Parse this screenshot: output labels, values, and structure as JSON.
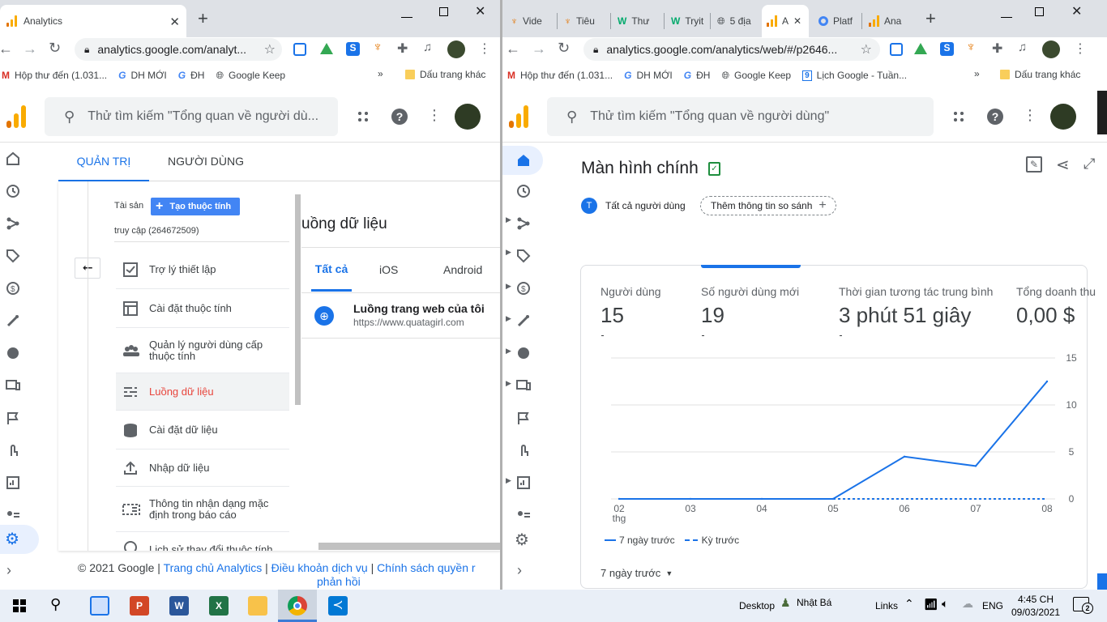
{
  "left_window": {
    "tab_title": "Analytics",
    "url": "analytics.google.com/analyt...",
    "bookmarks": [
      "Hộp thư đến (1.031...",
      "DH MỚI",
      "ĐH",
      "Google Keep"
    ],
    "bookmarks_other": "Dấu trang khác",
    "search_placeholder": "Thử tìm kiếm \"Tổng quan về người dù...",
    "tabs": [
      "QUẢN TRỊ",
      "NGƯỜI DÙNG"
    ],
    "property_label": "Tài sản",
    "create_property": "Tạo thuộc tính",
    "property_name": "truy cập (264672509)",
    "menu": [
      {
        "label": "Trợ lý thiết lập",
        "icon": "checklist-icon"
      },
      {
        "label": "Cài đặt thuộc tính",
        "icon": "property-settings-icon"
      },
      {
        "label": "Quản lý người dùng cấp thuộc tính",
        "icon": "people-icon"
      },
      {
        "label": "Luồng dữ liệu",
        "icon": "data-streams-icon"
      },
      {
        "label": "Cài đặt dữ liệu",
        "icon": "database-icon"
      },
      {
        "label": "Nhập dữ liệu",
        "icon": "upload-icon"
      },
      {
        "label": "Thông tin nhận dạng mặc định trong báo cáo",
        "icon": "reporting-identity-icon"
      },
      {
        "label": "Lịch sử thay đổi thuộc tính",
        "icon": "history-icon"
      }
    ],
    "streams_title": "uồng dữ liệu",
    "stream_tabs": [
      "Tất cả",
      "iOS",
      "Android"
    ],
    "stream_name": "Luồng trang web của tôi",
    "stream_url": "https://www.quatagirl.com",
    "footer": {
      "copyright": "© 2021 Google |",
      "link1": "Trang chủ Analytics",
      "sep": "|",
      "link2": "Điều khoản dịch vụ",
      "link3": "Chính sách quyền r",
      "link3b": "phản hồi"
    }
  },
  "right_window": {
    "tabs": [
      "Vide",
      "Tiêu",
      "Thư",
      "Tryit",
      "5 địa",
      "A",
      "Platf",
      "Ana"
    ],
    "url": "analytics.google.com/analytics/web/#/p2646...",
    "bookmarks": [
      "Hộp thư đến (1.031...",
      "DH MỚI",
      "ĐH",
      "Google Keep",
      "Lịch Google - Tuần..."
    ],
    "bookmarks_other": "Dấu trang khác",
    "search_placeholder": "Thử tìm kiếm \"Tổng quan về người dùng\"",
    "page_title": "Màn hình chính",
    "chip_all_users": "Tất cả người dùng",
    "chip_avatar_letter": "T",
    "chip_add_compare": "Thêm thông tin so sánh",
    "metrics": [
      {
        "title": "Người dùng",
        "value": "15"
      },
      {
        "title": "Số người dùng mới",
        "value": "19"
      },
      {
        "title": "Thời gian tương tác trung bình",
        "value": "3 phút 51 giây"
      },
      {
        "title": "Tổng doanh thu",
        "value": "0,00 $"
      }
    ],
    "legend_current": "7 ngày trước",
    "legend_previous": "Kỳ trước",
    "range_selector": "7 ngày trước",
    "x_sub_label": "thg"
  },
  "chart_data": {
    "type": "line",
    "x": [
      "02",
      "03",
      "04",
      "05",
      "06",
      "07",
      "08"
    ],
    "series": [
      {
        "name": "7 ngày trước",
        "values": [
          0,
          0,
          0,
          0,
          4.5,
          3.5,
          12.5
        ]
      },
      {
        "name": "Kỳ trước",
        "values": [
          0,
          0,
          0,
          0,
          0,
          0,
          0
        ]
      }
    ],
    "yticks": [
      0,
      5,
      10,
      15
    ],
    "ylim": [
      0,
      15
    ],
    "grid": true,
    "legend": "bottom-left",
    "colors": {
      "current": "#1a73e8",
      "previous": "#1a73e8"
    }
  },
  "taskbar": {
    "desktop": "Desktop",
    "user": "Nhật Bá",
    "links": "Links",
    "lang": "ENG",
    "time": "4:45 CH",
    "date": "09/03/2021",
    "notifications": "2"
  },
  "colors": {
    "accent": "#1a73e8",
    "active_menu": "#e8453c",
    "ga_orange": "#f9ab00",
    "ga_dark_orange": "#e37400"
  }
}
